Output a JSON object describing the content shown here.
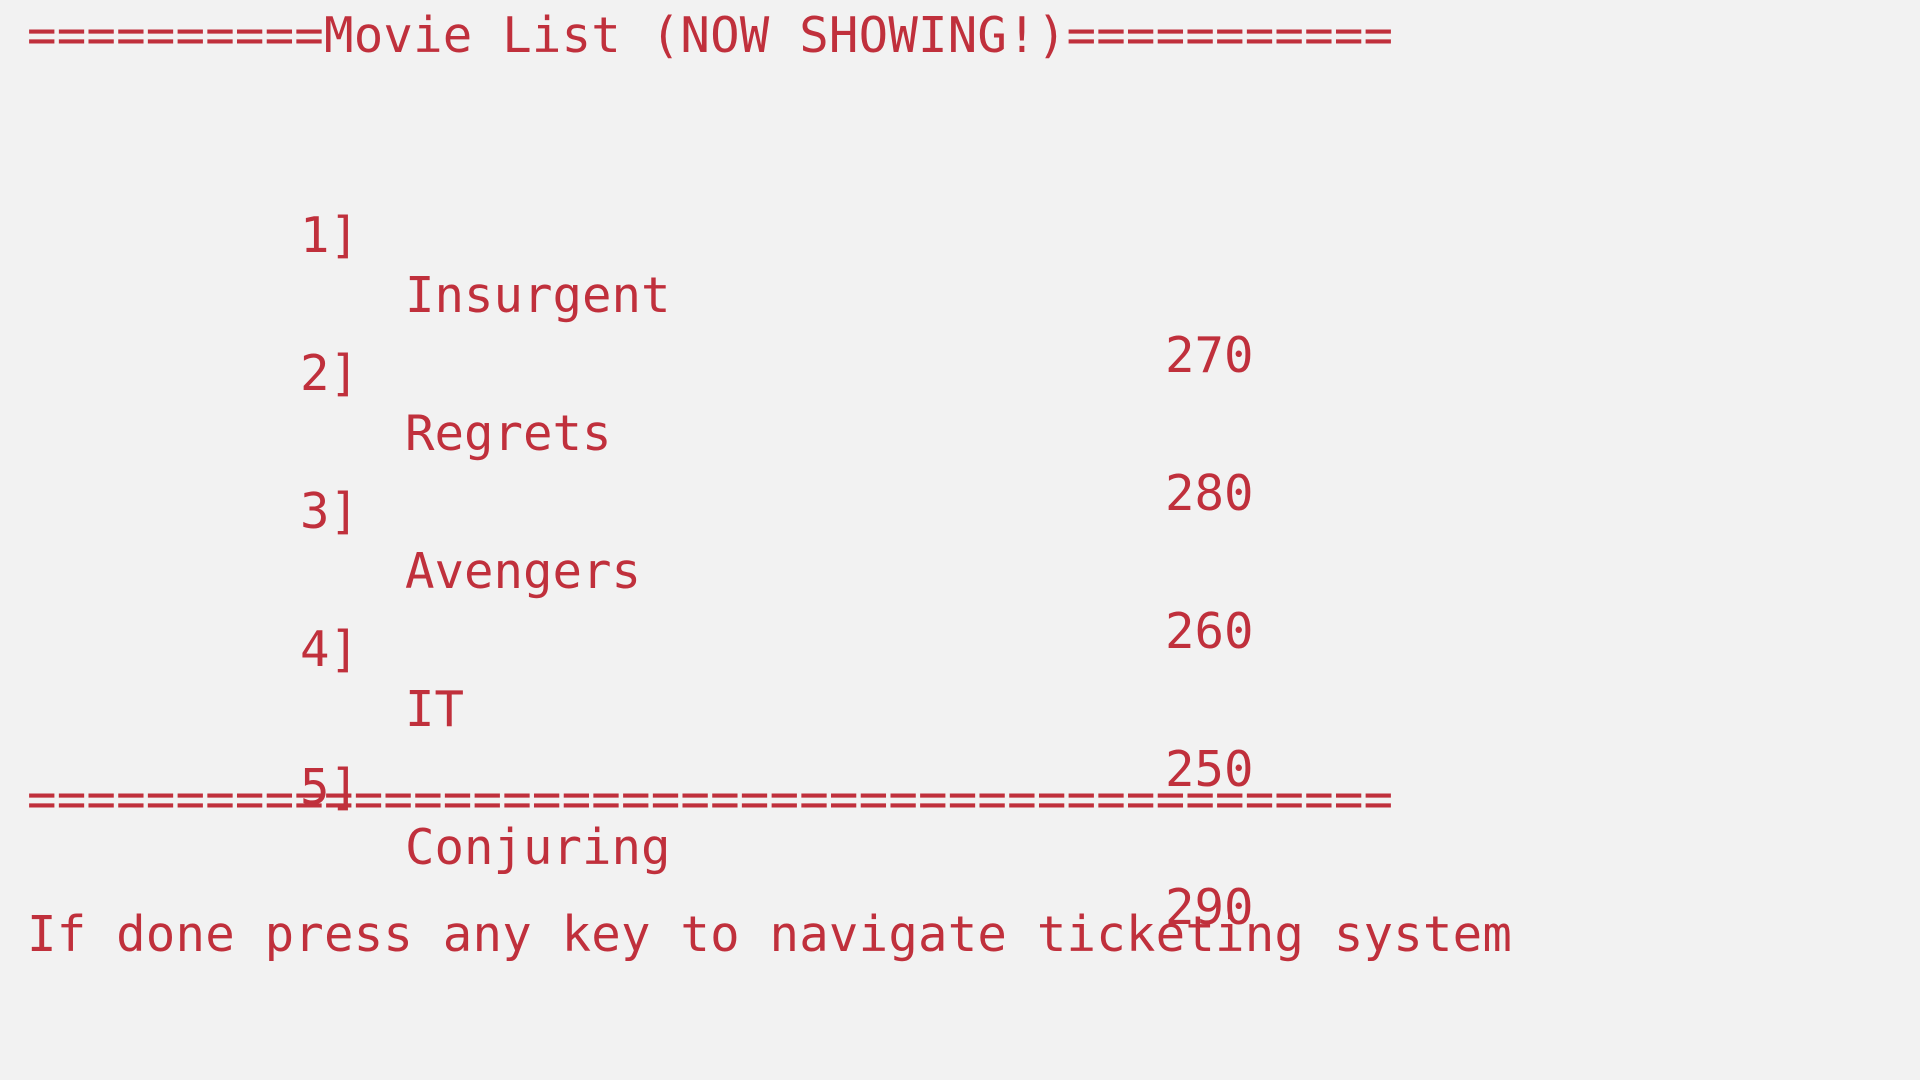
{
  "console": {
    "text_color": "#c0303c",
    "background_color": "#f2f2f2",
    "header_line": "==========Movie List (NOW SHOWING!)===========",
    "footer_rule": "==============================================",
    "prompt": "If done press any key to navigate ticketing system",
    "movies": [
      {
        "number": "1]",
        "title": "Insurgent",
        "price": "270"
      },
      {
        "number": "2]",
        "title": "Regrets",
        "price": "280"
      },
      {
        "number": "3]",
        "title": "Avengers",
        "price": "260"
      },
      {
        "number": "4]",
        "title": "IT",
        "price": "250"
      },
      {
        "number": "5]",
        "title": "Conjuring",
        "price": "290"
      }
    ]
  }
}
